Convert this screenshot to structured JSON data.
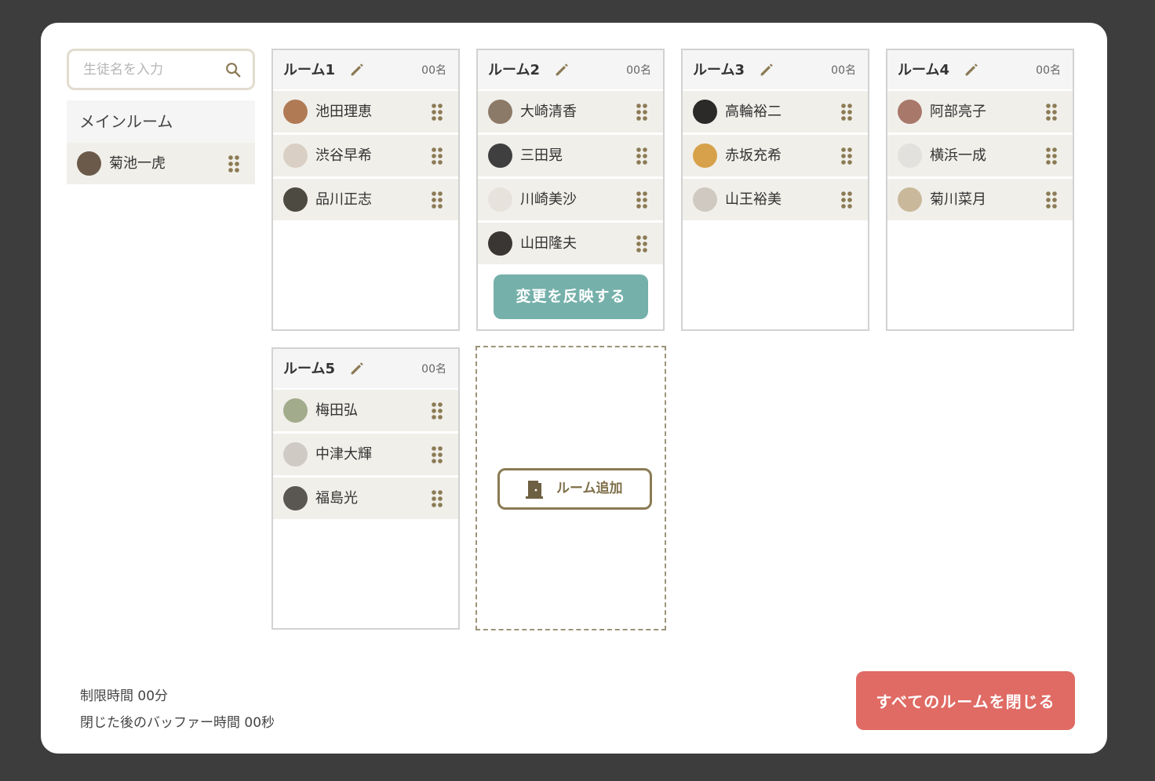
{
  "search": {
    "placeholder": "生徒名を入力"
  },
  "main_room": {
    "title": "メインルーム",
    "members": [
      {
        "name": "菊池一虎",
        "avatar_color": "#6b5a4a"
      }
    ]
  },
  "rooms": [
    {
      "title": "ルーム1",
      "count": "00名",
      "members": [
        {
          "name": "池田理恵",
          "avatar_color": "#b07a55"
        },
        {
          "name": "渋谷早希",
          "avatar_color": "#d9cfc4"
        },
        {
          "name": "品川正志",
          "avatar_color": "#4d4a42"
        }
      ]
    },
    {
      "title": "ルーム2",
      "count": "00名",
      "members": [
        {
          "name": "大崎清香",
          "avatar_color": "#8c7a68"
        },
        {
          "name": "三田晃",
          "avatar_color": "#3f3f40"
        },
        {
          "name": "川崎美沙",
          "avatar_color": "#e7e2dc"
        },
        {
          "name": "山田隆夫",
          "avatar_color": "#3a3633"
        }
      ],
      "apply_label": "変更を反映する"
    },
    {
      "title": "ルーム3",
      "count": "00名",
      "members": [
        {
          "name": "高輪裕二",
          "avatar_color": "#2c2a28"
        },
        {
          "name": "赤坂充希",
          "avatar_color": "#d6a14a"
        },
        {
          "name": "山王裕美",
          "avatar_color": "#cfc9c1"
        }
      ]
    },
    {
      "title": "ルーム4",
      "count": "00名",
      "members": [
        {
          "name": "阿部亮子",
          "avatar_color": "#a8786a"
        },
        {
          "name": "横浜一成",
          "avatar_color": "#e3e1de"
        },
        {
          "name": "菊川菜月",
          "avatar_color": "#c9b89a"
        }
      ]
    },
    {
      "title": "ルーム5",
      "count": "00名",
      "members": [
        {
          "name": "梅田弘",
          "avatar_color": "#a2ac8c"
        },
        {
          "name": "中津大輝",
          "avatar_color": "#cfcac4"
        },
        {
          "name": "福島光",
          "avatar_color": "#5a5652"
        }
      ]
    }
  ],
  "add_room": {
    "label": "ルーム追加"
  },
  "footer": {
    "time_limit": "制限時間 00分",
    "buffer_time": "閉じた後のバッファー時間 00秒",
    "close_all_label": "すべてのルームを閉じる"
  },
  "colors": {
    "accent": "#8b7b55",
    "apply": "#75b0aa",
    "danger": "#e06a64"
  },
  "icons": {
    "search": "search-icon",
    "edit": "pencil-icon",
    "drag": "drag-handle-icon",
    "door": "door-icon"
  }
}
